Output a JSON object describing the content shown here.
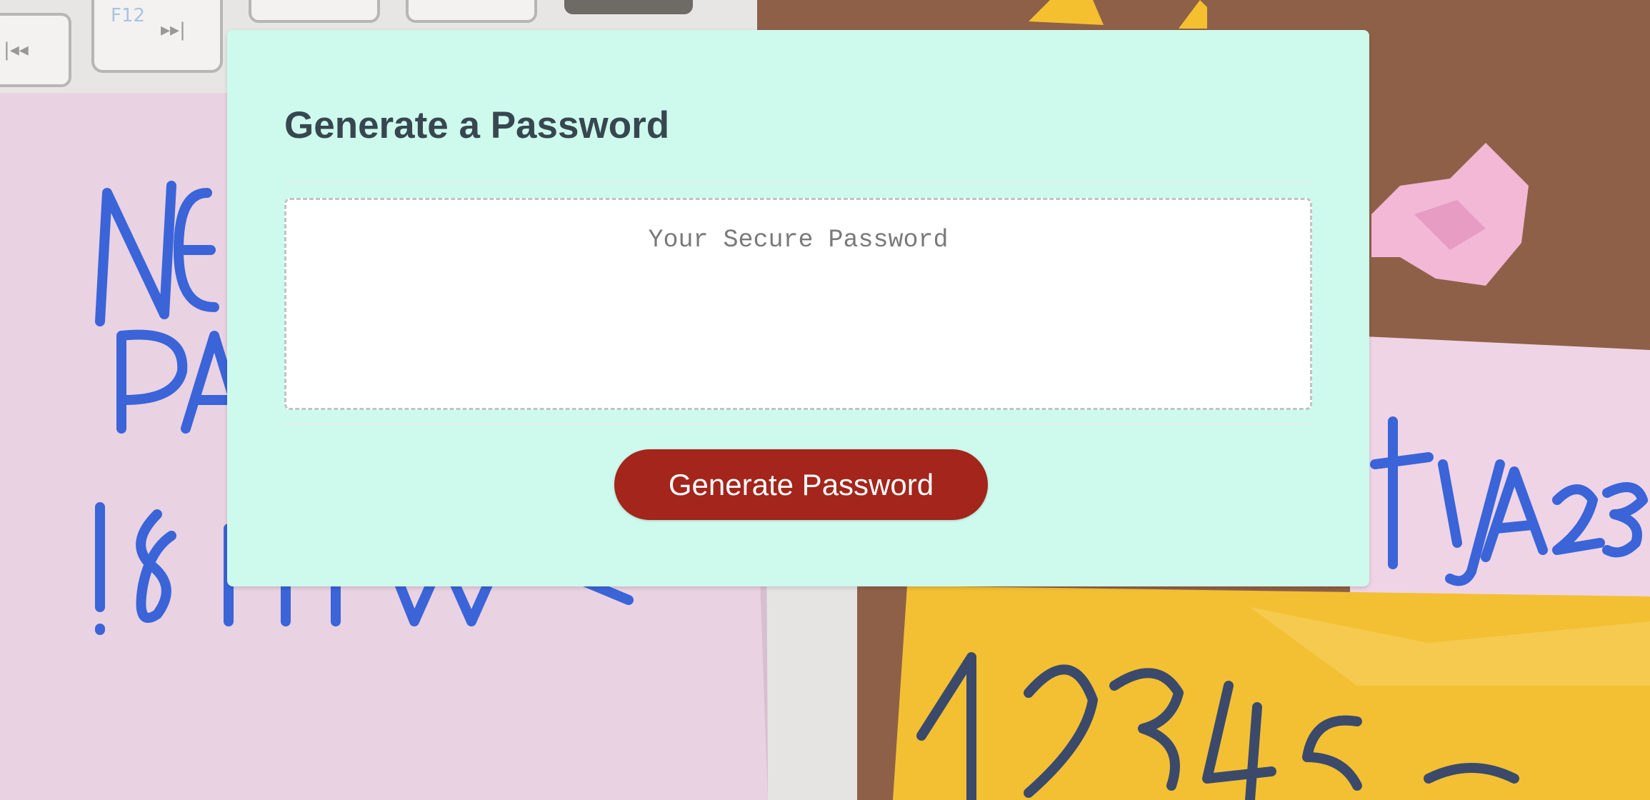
{
  "card": {
    "title": "Generate a Password"
  },
  "password": {
    "placeholder": "Your Secure Password",
    "value": ""
  },
  "actions": {
    "generate_label": "Generate Password"
  },
  "colors": {
    "card_background": "#cefaee",
    "button": "#a3251b",
    "title": "#37474f"
  }
}
